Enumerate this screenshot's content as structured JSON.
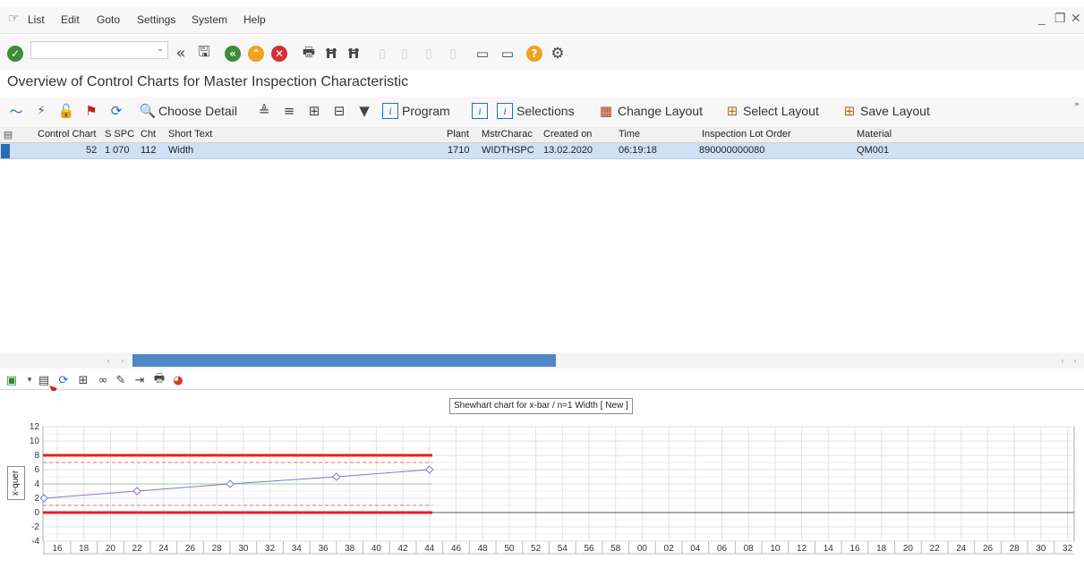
{
  "menubar": {
    "items": [
      "List",
      "Edit",
      "Goto",
      "Settings",
      "System",
      "Help"
    ]
  },
  "page_title": "Overview of Control Charts for Master Inspection Characteristic",
  "app_toolbar": {
    "choose_detail": "Choose Detail",
    "program": "Program",
    "selections": "Selections",
    "change_layout": "Change Layout",
    "select_layout": "Select Layout",
    "save_layout": "Save Layout"
  },
  "table": {
    "columns": [
      "Control Chart",
      "S SPC",
      "Cht",
      "Short Text",
      "Plant",
      "MstrCharac",
      "Created on",
      "Time",
      "Inspection Lot Order",
      "Material"
    ],
    "rows": [
      {
        "control_chart": "52",
        "s_spc": "1 070",
        "cht": "112",
        "short_text": "Width",
        "plant": "1710",
        "mstr_charac": "WIDTHSPC",
        "created_on": "13.02.2020",
        "time": "06:19:18",
        "inspection_lot_order": "890000000080",
        "material": "QM001"
      }
    ]
  },
  "chart": {
    "legend": "Shewhart chart for x-bar / n=1 Width [ New ]",
    "y_axis_label": "x-quer",
    "colors": {
      "limit_line": "#e8201c",
      "series_line": "#7b7bd0",
      "center_line": "#8fd08f",
      "warning_line": "#e07070"
    }
  },
  "chart_data": {
    "type": "line",
    "title": "Shewhart chart for x-bar / n=1 Width [ New ]",
    "ylabel": "x-quer",
    "ylim": [
      -4,
      12
    ],
    "yticks": [
      "12",
      "10",
      "8",
      "6",
      "4",
      "2",
      "0",
      "-2",
      "-4"
    ],
    "xticks": [
      "16",
      "18",
      "20",
      "22",
      "24",
      "26",
      "28",
      "30",
      "32",
      "34",
      "36",
      "38",
      "40",
      "42",
      "44",
      "46",
      "48",
      "50",
      "52",
      "54",
      "56",
      "58",
      "00",
      "02",
      "04",
      "06",
      "08",
      "10",
      "12",
      "14",
      "16",
      "18",
      "20",
      "22",
      "24",
      "26",
      "28",
      "30",
      "32"
    ],
    "series": [
      {
        "x": [
          "15",
          "22",
          "29",
          "37",
          "44"
        ],
        "values": [
          2,
          3,
          4,
          5,
          6
        ]
      }
    ],
    "limits": {
      "upper_control": 8,
      "lower_control": 0,
      "upper_warning": 7,
      "lower_warning": 1,
      "center": 4
    },
    "grid": true
  }
}
